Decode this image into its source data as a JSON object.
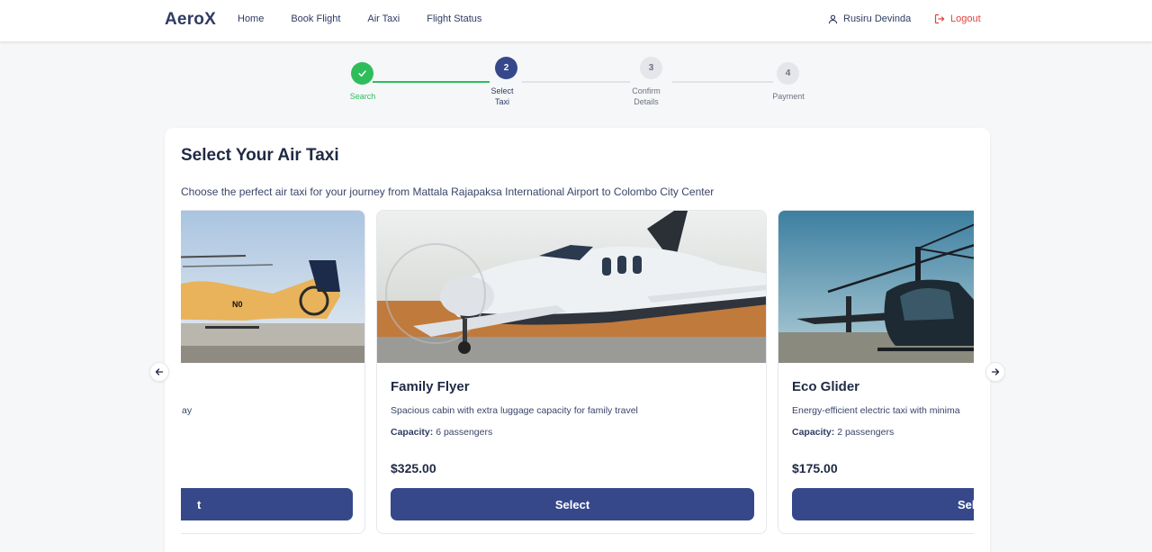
{
  "header": {
    "brand": "AeroX",
    "nav": [
      "Home",
      "Book Flight",
      "Air Taxi",
      "Flight Status"
    ],
    "user_name": "Rusiru Devinda",
    "logout_label": "Logout"
  },
  "stepper": {
    "steps": [
      {
        "number": "",
        "label": "Search",
        "state": "done"
      },
      {
        "number": "2",
        "label": "Select Taxi",
        "state": "active"
      },
      {
        "number": "3",
        "label": "Confirm Details",
        "state": "todo"
      },
      {
        "number": "4",
        "label": "Payment",
        "state": "todo"
      }
    ]
  },
  "main": {
    "title": "Select Your Air Taxi",
    "subtitle": "Choose the perfect air taxi for your journey from Mattala Rajapaksa International Airport to Colombo City Center",
    "capacity_label": "Capacity:",
    "taxis": [
      {
        "name": "",
        "desc_visible": "ay",
        "capacity": "",
        "price": "",
        "button": "t",
        "image": "helicopter-yellow"
      },
      {
        "name": "Family Flyer",
        "description": "Spacious cabin with extra luggage capacity for family travel",
        "capacity": "6 passengers",
        "price": "$325.00",
        "button": "Select",
        "image": "private-plane"
      },
      {
        "name": "Eco Glider",
        "description": "Energy-efficient electric taxi with minima",
        "capacity": "2 passengers",
        "price": "$175.00",
        "button": "Sel",
        "image": "helicopter-dark"
      }
    ]
  },
  "colors": {
    "primary": "#36488a",
    "success": "#2ebd5b",
    "danger": "#e0443a"
  }
}
